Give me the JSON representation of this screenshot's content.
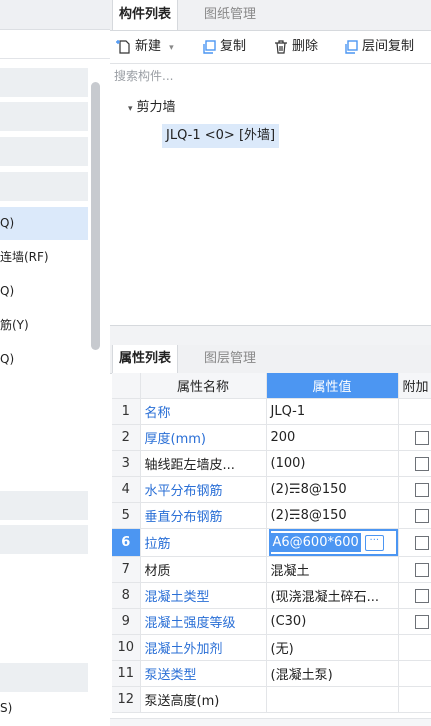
{
  "left_panel": {
    "items": [
      {
        "label": "Q)",
        "selected": true
      },
      {
        "label": "连墙(RF)",
        "selected": false
      },
      {
        "label": "Q)",
        "selected": false
      },
      {
        "label": "筋(Y)",
        "selected": false
      },
      {
        "label": "Q)",
        "selected": false
      }
    ],
    "bottom_label": "S)"
  },
  "component_tabs": [
    {
      "label": "构件列表",
      "active": true
    },
    {
      "label": "图纸管理",
      "active": false
    }
  ],
  "toolbar": {
    "new_label": "新建",
    "copy_label": "复制",
    "delete_label": "删除",
    "floor_copy_label": "层间复制"
  },
  "search": {
    "placeholder": "搜索构件..."
  },
  "tree": {
    "group_label": "剪力墙",
    "item_label": "JLQ-1 <0> [外墙]"
  },
  "property_tabs": [
    {
      "label": "属性列表",
      "active": true
    },
    {
      "label": "图层管理",
      "active": false
    }
  ],
  "property_table": {
    "headers": {
      "name": "属性名称",
      "value": "属性值",
      "extra": "附加"
    },
    "rows": [
      {
        "num": "1",
        "name": "名称",
        "value": "JLQ-1",
        "link": true,
        "checkbox": false
      },
      {
        "num": "2",
        "name": "厚度(mm)",
        "value": "200",
        "link": true,
        "checkbox": true
      },
      {
        "num": "3",
        "name": "轴线距左墙皮...",
        "value": "(100)",
        "link": false,
        "checkbox": true
      },
      {
        "num": "4",
        "name": "水平分布钢筋",
        "value": "(2)☴8@150",
        "link": true,
        "checkbox": true
      },
      {
        "num": "5",
        "name": "垂直分布钢筋",
        "value": "(2)☴8@150",
        "link": true,
        "checkbox": true
      },
      {
        "num": "6",
        "name": "拉筋",
        "value": "A6@600*600",
        "link": true,
        "checkbox": true,
        "selected": true
      },
      {
        "num": "7",
        "name": "材质",
        "value": "混凝土",
        "link": false,
        "checkbox": true
      },
      {
        "num": "8",
        "name": "混凝土类型",
        "value": "(现浇混凝土碎石...",
        "link": true,
        "checkbox": true
      },
      {
        "num": "9",
        "name": "混凝土强度等级",
        "value": "(C30)",
        "link": true,
        "checkbox": true
      },
      {
        "num": "10",
        "name": "混凝土外加剂",
        "value": "(无)",
        "link": true,
        "checkbox": false
      },
      {
        "num": "11",
        "name": "泵送类型",
        "value": "(混凝土泵)",
        "link": true,
        "checkbox": false
      },
      {
        "num": "12",
        "name": "泵送高度(m)",
        "value": "",
        "link": false,
        "checkbox": false
      }
    ]
  },
  "colors": {
    "accent": "#4c96f2",
    "link": "#2a6fd6",
    "selection_bg": "#dbe9fa"
  }
}
